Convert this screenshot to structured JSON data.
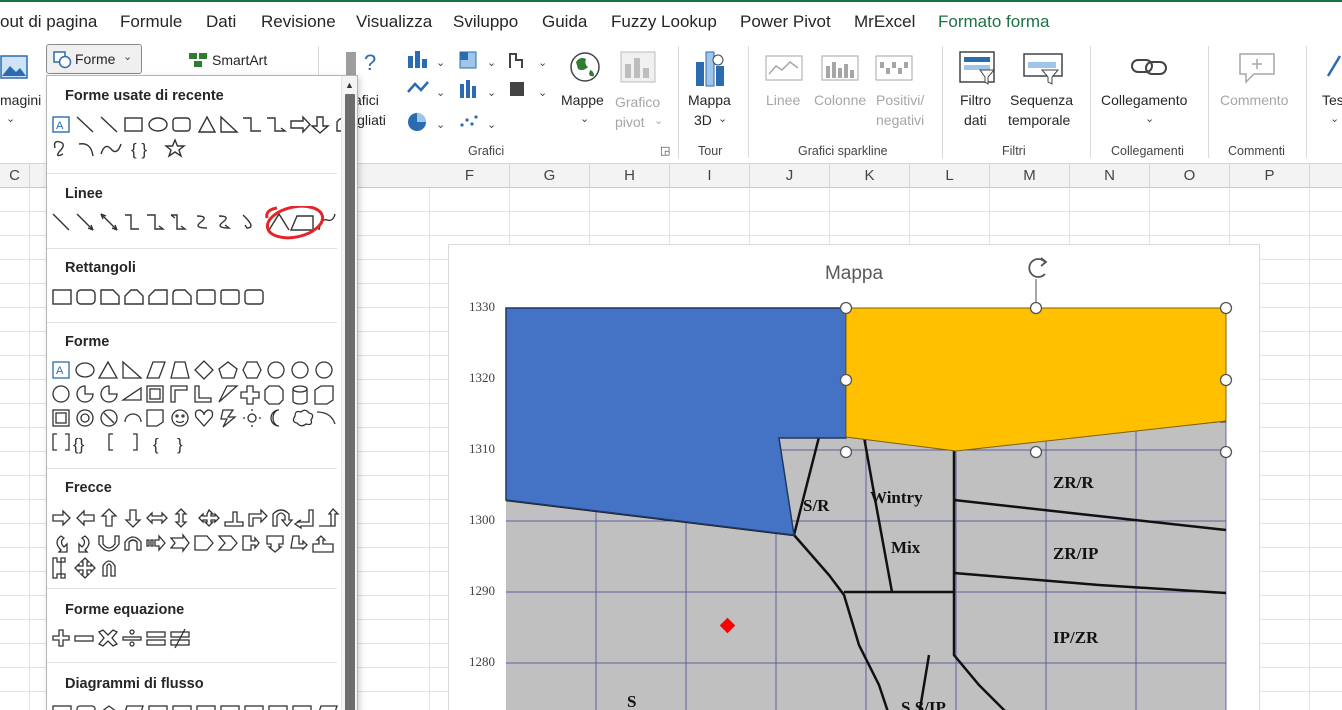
{
  "tabs": [
    "out di pagina",
    "Formule",
    "Dati",
    "Revisione",
    "Visualizza",
    "Sviluppo",
    "Guida",
    "Fuzzy Lookup",
    "Power Pivot",
    "MrExcel",
    "Formato forma"
  ],
  "ribbon": {
    "immagini_label": "magini",
    "forme_label": "Forme",
    "smartart_label": "SmartArt",
    "grafici_consigliati_1": "afici",
    "grafici_consigliati_2": "igliati",
    "mappe_label": "Mappe",
    "grafico_pivot_1": "Grafico",
    "grafico_pivot_2": "pivot",
    "group_grafici": "Grafici",
    "mappa3d_1": "Mappa",
    "mappa3d_2": "3D",
    "group_tour": "Tour",
    "sparkline_linee": "Linee",
    "sparkline_colonne": "Colonne",
    "sparkline_pos_1": "Positivi/",
    "sparkline_pos_2": "negativi",
    "group_sparkline": "Grafici sparkline",
    "filtro_1": "Filtro",
    "filtro_2": "dati",
    "sequenza_1": "Sequenza",
    "sequenza_2": "temporale",
    "group_filtri": "Filtri",
    "collegamento_label": "Collegamento",
    "group_collegamenti": "Collegamenti",
    "commento_label": "Commento",
    "group_commenti": "Commenti",
    "testo_label": "Tes"
  },
  "columns": [
    "C",
    "F",
    "G",
    "H",
    "I",
    "J",
    "K",
    "L",
    "M",
    "N",
    "O",
    "P"
  ],
  "dropdown": {
    "sections": {
      "recent": "Forme usate di recente",
      "lines": "Linee",
      "rects": "Rettangoli",
      "shapes": "Forme",
      "arrows": "Frecce",
      "equation": "Forme equazione",
      "flowchart": "Diagrammi di flusso"
    }
  },
  "chart": {
    "title": "Mappa",
    "y_ticks": [
      "1330",
      "1320",
      "1310",
      "1300",
      "1290",
      "1280"
    ],
    "labels": [
      "S/R",
      "Wintry",
      "Mix",
      "ZR/R",
      "ZR/IP",
      "IP/ZR",
      "S",
      "S S/IP"
    ],
    "colors": {
      "blue": "#4472c4",
      "orange": "#ffc000",
      "gray": "#c0c0c0",
      "marker": "#ff0000",
      "annotation": "#e5242a"
    }
  }
}
